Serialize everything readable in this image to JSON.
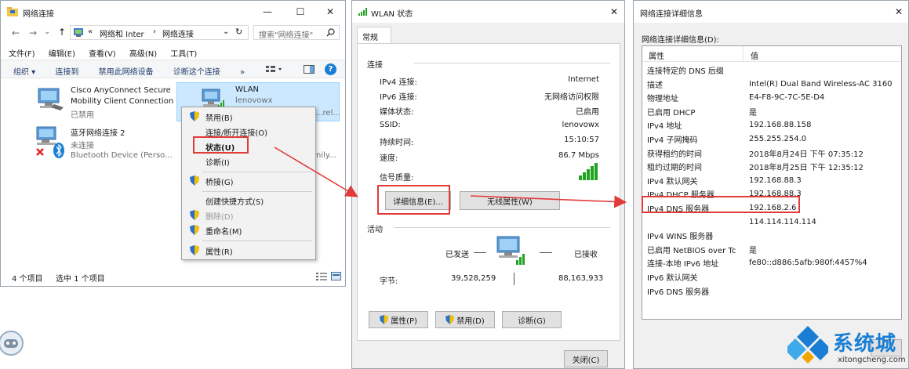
{
  "explorer": {
    "title": "网络连接",
    "controls": {
      "minimize": "—",
      "maximize": "☐",
      "close": "✕"
    },
    "nav": {
      "back": "←",
      "forward": "→",
      "dropdown": "⌄",
      "up": "↑"
    },
    "address": {
      "separator": "«",
      "crumb1": "网络和 Inter",
      "arrow": "›",
      "crumb2": "网络连接",
      "chevron": "⌄",
      "refresh": "↻"
    },
    "search_placeholder": "搜索\"网络连接\"",
    "menu": [
      "文件(F)",
      "编辑(E)",
      "查看(V)",
      "高级(N)",
      "工具(T)"
    ],
    "toolbar": [
      "组织 ▾",
      "连接到",
      "禁用此网络设备",
      "诊断这个连接",
      "»"
    ],
    "help": "?",
    "items": [
      {
        "name_line1": "Cisco AnyConnect Secure",
        "name_line2": "Mobility Client Connection",
        "status": "已禁用"
      },
      {
        "name_line1": "WLAN",
        "status": "lenovowx",
        "device": "...rel..."
      },
      {
        "name_line1": "蓝牙网络连接 2",
        "status": "未连接",
        "device": "Bluetooth Device (Perso...",
        "device_tail": "nily..."
      }
    ],
    "statusbar": {
      "count": "4 个项目",
      "selected": "选中 1 个项目"
    }
  },
  "context_menu": {
    "items": [
      "禁用(B)",
      "连接/断开连接(O)",
      "状态(U)",
      "诊断(I)",
      "桥接(G)",
      "创建快捷方式(S)",
      "删除(D)",
      "重命名(M)",
      "属性(R)"
    ]
  },
  "wlan": {
    "title": "WLAN 状态",
    "close": "✕",
    "tab": "常规",
    "connection_label": "连接",
    "rows": [
      {
        "k": "IPv4 连接:",
        "v": "Internet"
      },
      {
        "k": "IPv6 连接:",
        "v": "无网络访问权限"
      },
      {
        "k": "媒体状态:",
        "v": "已启用"
      },
      {
        "k": "SSID:",
        "v": "lenovowx"
      },
      {
        "k": "持续时间:",
        "v": "15:10:57"
      },
      {
        "k": "速度:",
        "v": "86.7 Mbps"
      }
    ],
    "signal_label": "信号质量:",
    "details_button": "详细信息(E)...",
    "wireless_button": "无线属性(W)",
    "activity_label": "活动",
    "sent_label": "已发送",
    "received_label": "已接收",
    "bytes_label": "字节:",
    "bytes_sent": "39,528,259",
    "bytes_received": "88,163,933",
    "properties_button": "属性(P)",
    "disable_button": "禁用(D)",
    "diagnose_button": "诊断(G)",
    "close_button": "关闭(C)"
  },
  "details": {
    "title": "网络连接详细信息",
    "close": "✕",
    "caption": "网络连接详细信息(D):",
    "header_property": "属性",
    "header_value": "值",
    "rows": [
      {
        "k": "连接特定的 DNS 后缀",
        "v": ""
      },
      {
        "k": "描述",
        "v": "Intel(R) Dual Band Wireless-AC 3160"
      },
      {
        "k": "物理地址",
        "v": "E4-F8-9C-7C-5E-D4"
      },
      {
        "k": "已启用 DHCP",
        "v": "是"
      },
      {
        "k": "IPv4 地址",
        "v": "192.168.88.158"
      },
      {
        "k": "IPv4 子网掩码",
        "v": "255.255.254.0"
      },
      {
        "k": "获得租约的时间",
        "v": "2018年8月24日 下午 07:35:12"
      },
      {
        "k": "租约过期的时间",
        "v": "2018年8月25日 下午 12:35:12"
      },
      {
        "k": "IPv4 默认网关",
        "v": "192.168.88.3"
      },
      {
        "k": "IPv4 DHCP 服务器",
        "v": "192.168.88.3"
      },
      {
        "k": "IPv4 DNS 服务器",
        "v": "192.168.2.6"
      },
      {
        "k": "",
        "v": "114.114.114.114"
      },
      {
        "k": "IPv4 WINS 服务器",
        "v": ""
      },
      {
        "k": "已启用 NetBIOS over Tc",
        "v": "是"
      },
      {
        "k": "连接-本地 IPv6 地址",
        "v": "fe80::d886:5afb:980f:4457%4"
      },
      {
        "k": "IPv6 默认网关",
        "v": ""
      },
      {
        "k": "IPv6 DNS 服务器",
        "v": ""
      }
    ]
  },
  "watermark": {
    "brand": "系统城",
    "url": "xitongcheng.com"
  },
  "colors": {
    "accent": "#1a7fd4",
    "highlight": "#cce8ff",
    "annotation": "#e33a3a",
    "signal": "#1fa320"
  }
}
